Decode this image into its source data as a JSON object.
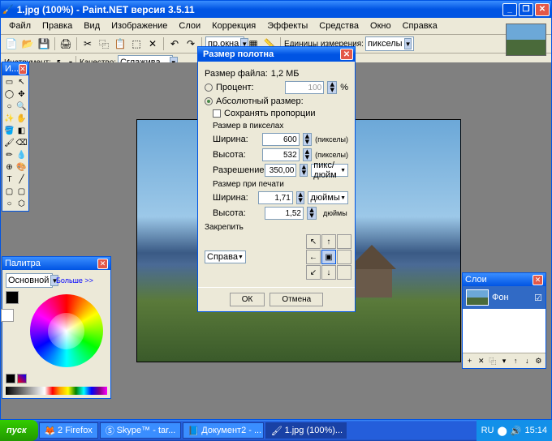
{
  "main_window": {
    "title": "1.jpg (100%) - Paint.NET версия 3.5.11"
  },
  "menubar": {
    "file": "Файл",
    "edit": "Правка",
    "view": "Вид",
    "image": "Изображение",
    "layers": "Слои",
    "adjustments": "Коррекция",
    "effects": "Эффекты",
    "tools": "Средства",
    "window": "Окно",
    "help": "Справка"
  },
  "toolbar": {
    "units_label": "Единицы измерения:",
    "units_value": "пикселы",
    "instrument_label": "Инструмент:",
    "quality_label": "Качество:",
    "quality_value": "Сглажива...",
    "fit_window": "пр.окна"
  },
  "dialog": {
    "title": "Размер полотна",
    "filesize_label": "Размер файла:",
    "filesize_value": "1,2 МБ",
    "percent_label": "Процент:",
    "percent_value": "100",
    "percent_unit": "%",
    "absolute_label": "Абсолютный размер:",
    "keep_proportions": "Сохранять пропорции",
    "pixel_size_label": "Размер в пикселах",
    "width_label": "Ширина:",
    "width_value": "600",
    "width_unit": "(пикселы)",
    "height_label": "Высота:",
    "height_value": "532",
    "height_unit": "(пикселы)",
    "resolution_label": "Разрешение:",
    "resolution_value": "350,00",
    "resolution_unit": "пикс/дюйм",
    "print_size_label": "Размер при печати",
    "print_width_label": "Ширина:",
    "print_width_value": "1,71",
    "print_width_unit": "дюймы",
    "print_height_label": "Высота:",
    "print_height_value": "1,52",
    "print_height_unit": "дюймы",
    "anchor_label": "Закрепить",
    "anchor_value": "Справа",
    "ok": "ОК",
    "cancel": "Отмена"
  },
  "tools_panel": {
    "title": "И..."
  },
  "palette": {
    "title": "Палитра",
    "primary": "Основной",
    "more": "Больше >>"
  },
  "layers": {
    "title": "Слои",
    "item": "Фон"
  },
  "taskbar": {
    "start": "пуск",
    "task1": "2 Firefox",
    "task2": "Skype™ - tar...",
    "task3": "Документ2 - ...",
    "task4": "1.jpg (100%)...",
    "time": "15:14",
    "lang": "RU"
  }
}
